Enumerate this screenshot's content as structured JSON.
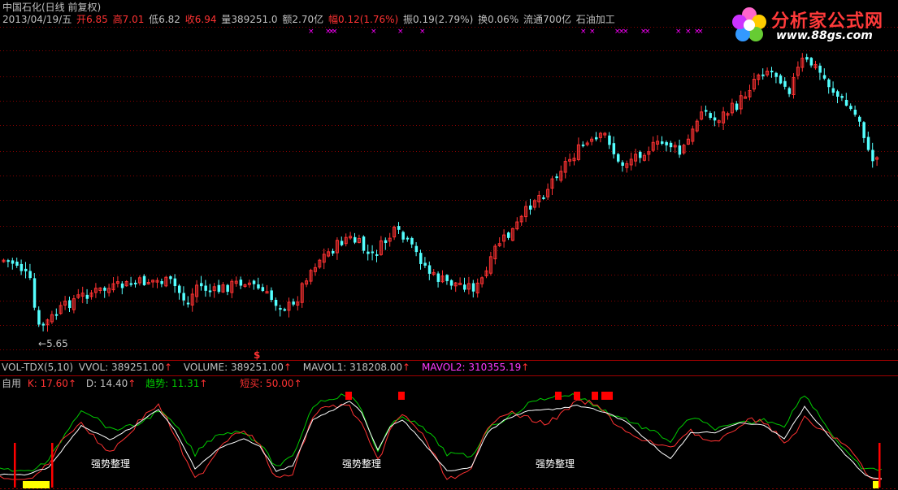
{
  "header": {
    "title": "中国石化(日线 前复权)",
    "date_label": "2013/04/19/五",
    "open_label": "开",
    "open": "6.85",
    "high_label": "高",
    "high": "7.01",
    "low_label": "低",
    "low": "6.82",
    "close_label": "收",
    "close": "6.94",
    "volume_label": "量",
    "volume": "389251.0",
    "amount_label": "额",
    "amount": "2.70亿",
    "change_label": "幅",
    "change": "0.12(1.76%)",
    "amplitude_label": "振",
    "amplitude": "0.19(2.79%)",
    "turnover_label": "换",
    "turnover": "0.06%",
    "float_label": "流通",
    "float": "700亿",
    "industry": "石油加工"
  },
  "watermark": {
    "brand": "分析家公式网",
    "url": "www.88gs.com"
  },
  "price_panel": {
    "low_marker": "5.65",
    "signal_marker": "$"
  },
  "volume_panel": {
    "indicator": "VOL-TDX(5,10)",
    "vvol": "VVOL: 389251.00",
    "volume": "VOLUME: 389251.00",
    "mavol1": "MAVOL1: 318208.00",
    "mavol2": "MAVOL2: 310355.19",
    "arrow": "↑"
  },
  "kd_panel": {
    "indicator": "自用",
    "k": "K: 17.60",
    "d": "D: 14.40",
    "trend": "趋势: 11.31",
    "short_buy": "短买: 50.00",
    "arrow": "↑",
    "annotations": [
      "强势整理",
      "强势整理",
      "强势整理"
    ]
  },
  "colors": {
    "up": "#ff3232",
    "down": "#54ffff",
    "grid": "#8a0000",
    "trend_line": "#00cc00",
    "k_line": "#ffffff",
    "d_line": "#ffff00",
    "mavol2": "#ff3aff",
    "marker": "#ff00ff"
  }
}
